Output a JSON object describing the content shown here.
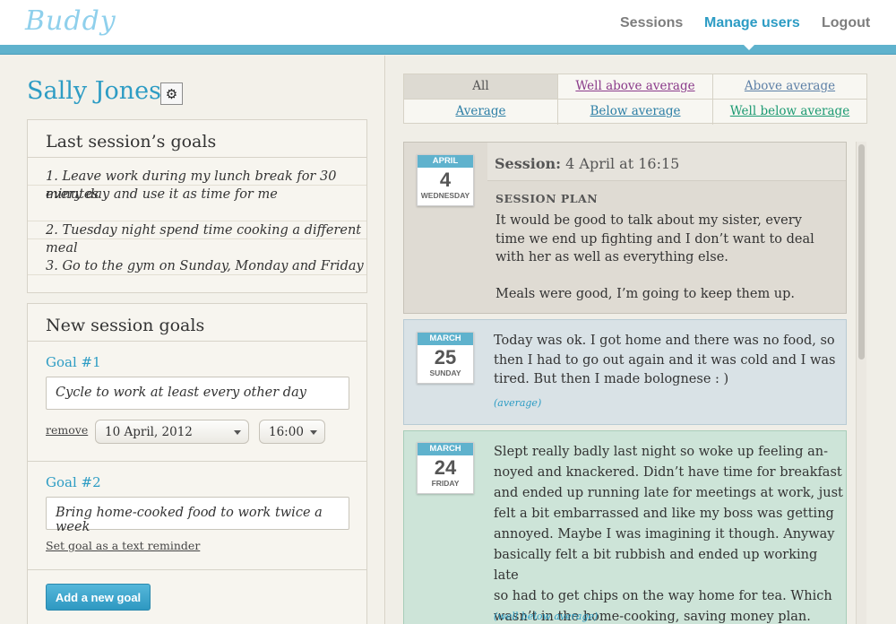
{
  "app": {
    "logo": "Buddy"
  },
  "nav": {
    "sessions": "Sessions",
    "manage_users": "Manage users",
    "logout": "Logout"
  },
  "user": {
    "name": "Sally Jones",
    "settings_icon": "gear-icon"
  },
  "last_goals": {
    "title": "Last session’s goals",
    "items": [
      "1. Leave work during my lunch break for 30 minutes",
      "every day and use it as time for me",
      "2. Tuesday night spend time cooking a different meal",
      "3. Go to the gym on Sunday, Monday and Friday"
    ]
  },
  "new_goals": {
    "title": "New session goals",
    "goal1": {
      "label": "Goal #1",
      "value": "Cycle to work at least every other day",
      "remove": "remove",
      "date": "10 April, 2012",
      "time": "16:00"
    },
    "goal2": {
      "label": "Goal #2",
      "value": "Bring home-cooked food to work twice a week",
      "reminder": "Set goal as a text reminder"
    },
    "add_button": "Add a new goal"
  },
  "filters": [
    "All",
    "Well above average",
    "Above average",
    "Average",
    "Below average",
    "Well below average"
  ],
  "colors": {
    "accent": "#2d9cc4",
    "well_above": "#8a3a8a",
    "below": "#2d7fa6",
    "well_below": "#1b9a72"
  },
  "sessions": [
    {
      "month": "April",
      "day": "4",
      "weekday": "Wednesday",
      "heading_label": "Session:",
      "heading_value": "4 April at 16:15",
      "plan_label": "SESSION PLAN",
      "plan_lines": [
        "It would be good to talk about my sister, every",
        "time we end up fighting and I don’t want to deal",
        "with her as well as everything else.",
        "",
        "Meals were good, I’m going to keep them up."
      ]
    },
    {
      "month": "March",
      "day": "25",
      "weekday": "Sunday",
      "lines": [
        "Today was ok. I got home and there was no food, so",
        "then I had to go out again and it was cold and I was",
        "tired. But then I made bolognese : )"
      ],
      "rating": "(average)"
    },
    {
      "month": "March",
      "day": "24",
      "weekday": "Friday",
      "lines": [
        "Slept really badly last night so woke up feeling an-",
        "noyed and knackered. Didn’t have time for breakfast",
        "and ended up running late for meetings at work, just",
        "felt a bit embarrassed and like my boss was getting",
        "annoyed. Maybe I was imagining it though. Anyway",
        "basically felt a bit rubbish and ended up working late",
        "so had to get chips on the way home for tea. Which",
        "wasn’t in the home-cooking, saving money plan."
      ],
      "rating": "(well below average)"
    }
  ]
}
